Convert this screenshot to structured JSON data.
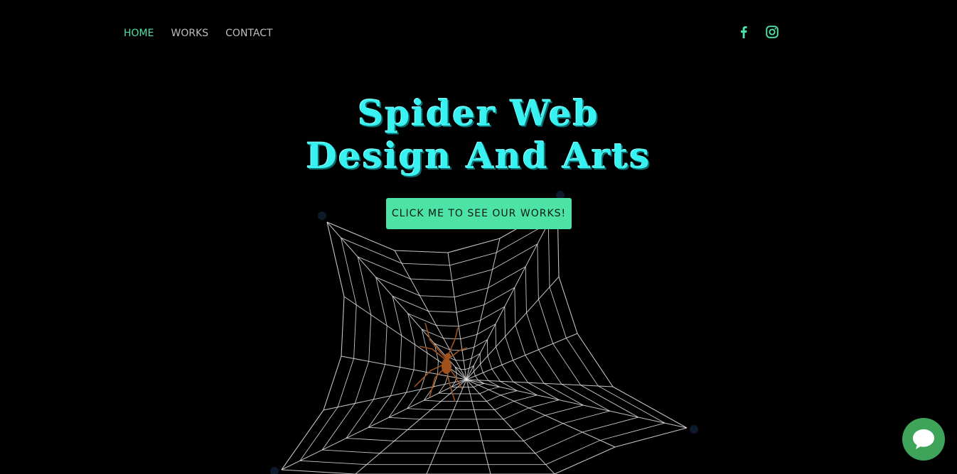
{
  "nav": {
    "items": [
      {
        "label": "HOME",
        "active": true
      },
      {
        "label": "WORKS",
        "active": false
      },
      {
        "label": "CONTACT",
        "active": false
      }
    ]
  },
  "social": {
    "icons": [
      "facebook-icon",
      "instagram-icon"
    ],
    "color": "#4de3a6"
  },
  "hero": {
    "title_line1": "Spider Web",
    "title_line2": "Design And Arts",
    "title_color": "#38f2f2",
    "cta_label": "CLICK ME TO SEE OUR WORKS!",
    "cta_color": "#4de3a6"
  },
  "illustration": {
    "subject": "spider-web",
    "web_color": "#e6e6e6",
    "spider_color": "#a0521d"
  },
  "chat": {
    "icon": "chat-bubble-icon",
    "color": "#3da45a"
  },
  "colors": {
    "background": "#000000",
    "accent": "#4de3a6",
    "nav_text": "#bdbdbd"
  }
}
